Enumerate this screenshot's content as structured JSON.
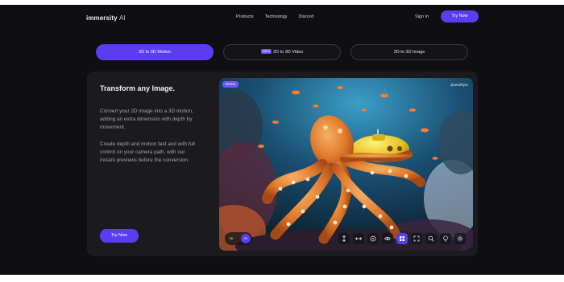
{
  "nav": {
    "logo_main": "immersity",
    "logo_ai": "AI",
    "links": [
      "Products",
      "Technology",
      "Discord"
    ],
    "signin": "Sign In",
    "try_now": "Try Now"
  },
  "tabs": [
    {
      "label": "2D to 3D Motion",
      "active": true
    },
    {
      "label": "2D to 3D Video",
      "badge": "NEW",
      "active": false
    },
    {
      "label": "2D to 3D Image",
      "active": false
    }
  ],
  "panel": {
    "heading": "Transform any Image.",
    "para1": "Convert your 2D image into a 3D motion, adding an extra dimension with depth by movement.",
    "para2": "Create depth and motion fast and with full control on your camera path, with our instant previews before the conversion.",
    "try_now": "Try Now"
  },
  "preview": {
    "demo_badge": "Demo",
    "credit": "@artofkyro",
    "mode_2d": "2D",
    "mode_3d": "3D",
    "tools": [
      "vertical-move-icon",
      "horizontal-move-icon",
      "orbit-icon",
      "eye-icon",
      "grid-icon",
      "expand-icon",
      "zoom-icon",
      "bulb-icon",
      "settings-icon"
    ],
    "active_tool": "grid-icon"
  },
  "colors": {
    "accent": "#5b3cf0",
    "background": "#0f0f12",
    "panel": "#1a1a1f"
  }
}
